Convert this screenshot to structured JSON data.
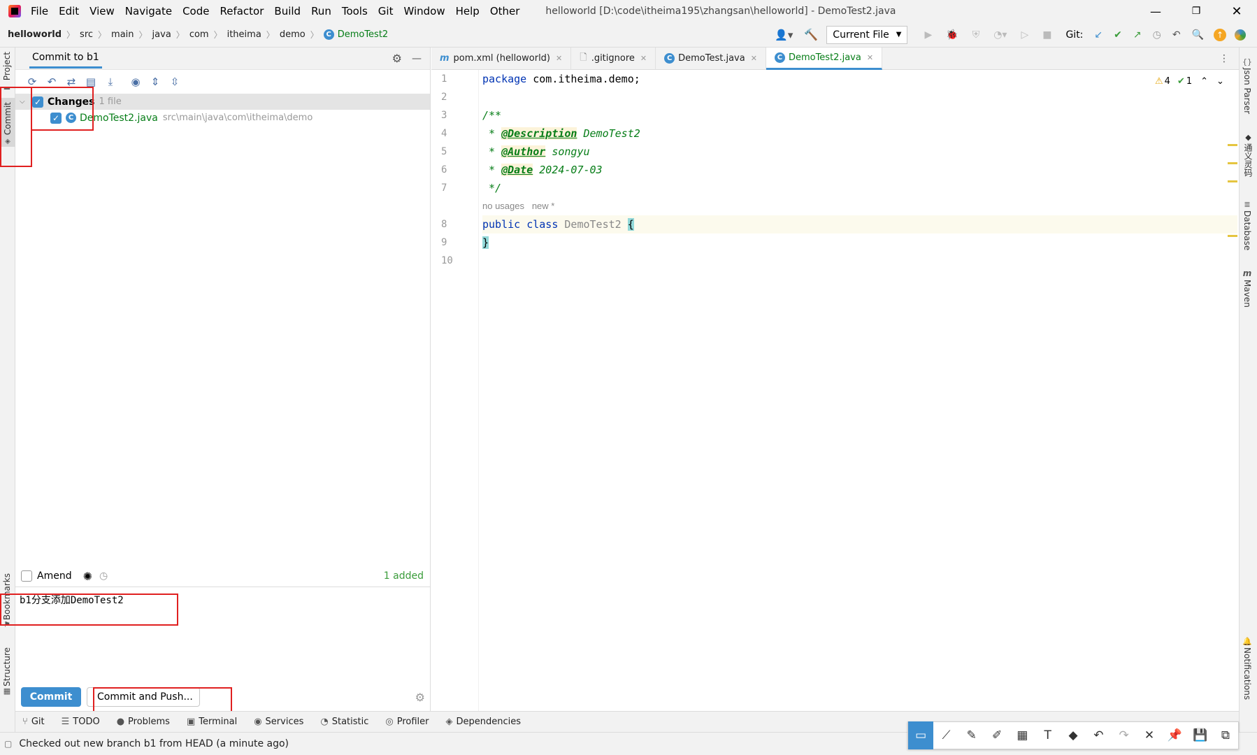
{
  "menu": [
    "File",
    "Edit",
    "View",
    "Navigate",
    "Code",
    "Refactor",
    "Build",
    "Run",
    "Tools",
    "Git",
    "Window",
    "Help",
    "Other"
  ],
  "window_title": "helloworld [D:\\code\\itheima195\\zhangsan\\helloworld] - DemoTest2.java",
  "breadcrumb": [
    "helloworld",
    "src",
    "main",
    "java",
    "com",
    "itheima",
    "demo",
    "DemoTest2"
  ],
  "run_config": "Current File",
  "git_label": "Git:",
  "left_strip": {
    "project": "Project",
    "commit": "Commit",
    "bookmarks": "Bookmarks",
    "structure": "Structure"
  },
  "right_strip": {
    "json": "Json Parser",
    "cn": "通义灵码",
    "database": "Database",
    "maven": "Maven",
    "notifications": "Notifications"
  },
  "commit_panel": {
    "title": "Commit to b1",
    "changes_label": "Changes",
    "changes_count": "1 file",
    "file_name": "DemoTest2.java",
    "file_path": "src\\main\\java\\com\\itheima\\demo",
    "amend": "Amend",
    "added": "1 added",
    "message": "b1分支添加DemoTest2",
    "commit_btn": "Commit",
    "commit_push_btn": "Commit and Push..."
  },
  "editor_tabs": [
    {
      "label": "pom.xml (helloworld)",
      "icon": "m"
    },
    {
      "label": ".gitignore",
      "icon": "file"
    },
    {
      "label": "DemoTest.java",
      "icon": "c"
    },
    {
      "label": "DemoTest2.java",
      "icon": "c"
    }
  ],
  "inspections": {
    "warnings": "4",
    "checks": "1"
  },
  "code": {
    "line_numbers": [
      "1",
      "2",
      "3",
      "4",
      "5",
      "6",
      "7",
      "8",
      "9",
      "10"
    ],
    "pkg_kw": "package",
    "pkg_name": " com.itheima.demo;",
    "doc_open": "/**",
    "desc_tag": "@Description",
    "desc_val": " DemoTest2",
    "author_tag": "@Author",
    "author_val": " songyu",
    "date_tag": "@Date",
    "date_val": " 2024-07-03",
    "doc_close": " */",
    "hint": "no usages   new *",
    "class_kw": "public class",
    "class_name": " DemoTest2 ",
    "brace_open": "{",
    "brace_close": "}"
  },
  "tool_windows": [
    {
      "label": "Git",
      "icon": "branch-icon"
    },
    {
      "label": "TODO",
      "icon": "list-icon"
    },
    {
      "label": "Problems",
      "icon": "problems-icon"
    },
    {
      "label": "Terminal",
      "icon": "terminal-icon"
    },
    {
      "label": "Services",
      "icon": "services-icon"
    },
    {
      "label": "Statistic",
      "icon": "statistic-icon"
    },
    {
      "label": "Profiler",
      "icon": "profiler-icon"
    },
    {
      "label": "Dependencies",
      "icon": "dependencies-icon"
    }
  ],
  "status": "Checked out new branch b1 from HEAD (a minute ago)",
  "colors": {
    "accent": "#3d8ecf",
    "annotation_red": "#e02020",
    "doc_green": "#067d17",
    "keyword_blue": "#0033b3"
  }
}
